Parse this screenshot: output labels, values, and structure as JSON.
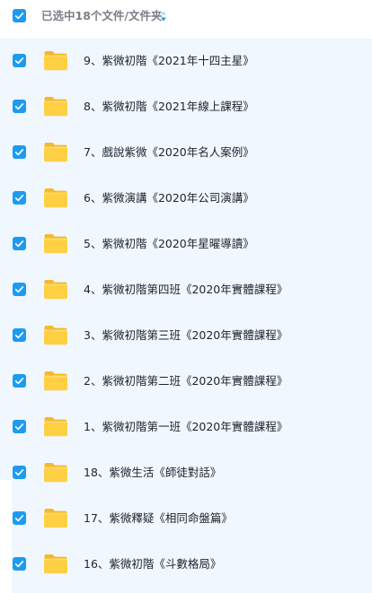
{
  "header": {
    "selection_label": "已选中18个文件/文件夹",
    "select_all_checked": true,
    "sort_icon": "sort-arrows-icon"
  },
  "colors": {
    "accent": "#1d9bf0",
    "list_background": "#f0f7ff",
    "folder_yellow": "#ffc93c"
  },
  "rows": [
    {
      "label": "9、紫微初階《2021年十四主星》",
      "checked": true,
      "icon": "folder-icon"
    },
    {
      "label": "8、紫微初階《2021年線上課程》",
      "checked": true,
      "icon": "folder-icon"
    },
    {
      "label": "7、戲說紫微《2020年名人案例》",
      "checked": true,
      "icon": "folder-icon"
    },
    {
      "label": "6、紫微演講《2020年公司演講》",
      "checked": true,
      "icon": "folder-icon"
    },
    {
      "label": "5、紫微初階《2020年星曜導讀》",
      "checked": true,
      "icon": "folder-icon"
    },
    {
      "label": "4、紫微初階第四班《2020年實體課程》",
      "checked": true,
      "icon": "folder-icon"
    },
    {
      "label": "3、紫微初階第三班《2020年實體課程》",
      "checked": true,
      "icon": "folder-icon"
    },
    {
      "label": "2、紫微初階第二班《2020年實體課程》",
      "checked": true,
      "icon": "folder-icon"
    },
    {
      "label": "1、紫微初階第一班《2020年實體課程》",
      "checked": true,
      "icon": "folder-icon"
    },
    {
      "label": "18、紫微生活《師徒對話》",
      "checked": true,
      "icon": "folder-icon"
    },
    {
      "label": "17、紫微釋疑《相同命盤篇》",
      "checked": true,
      "icon": "folder-icon"
    },
    {
      "label": "16、紫微初階《斗數格局》",
      "checked": true,
      "icon": "folder-icon"
    }
  ]
}
